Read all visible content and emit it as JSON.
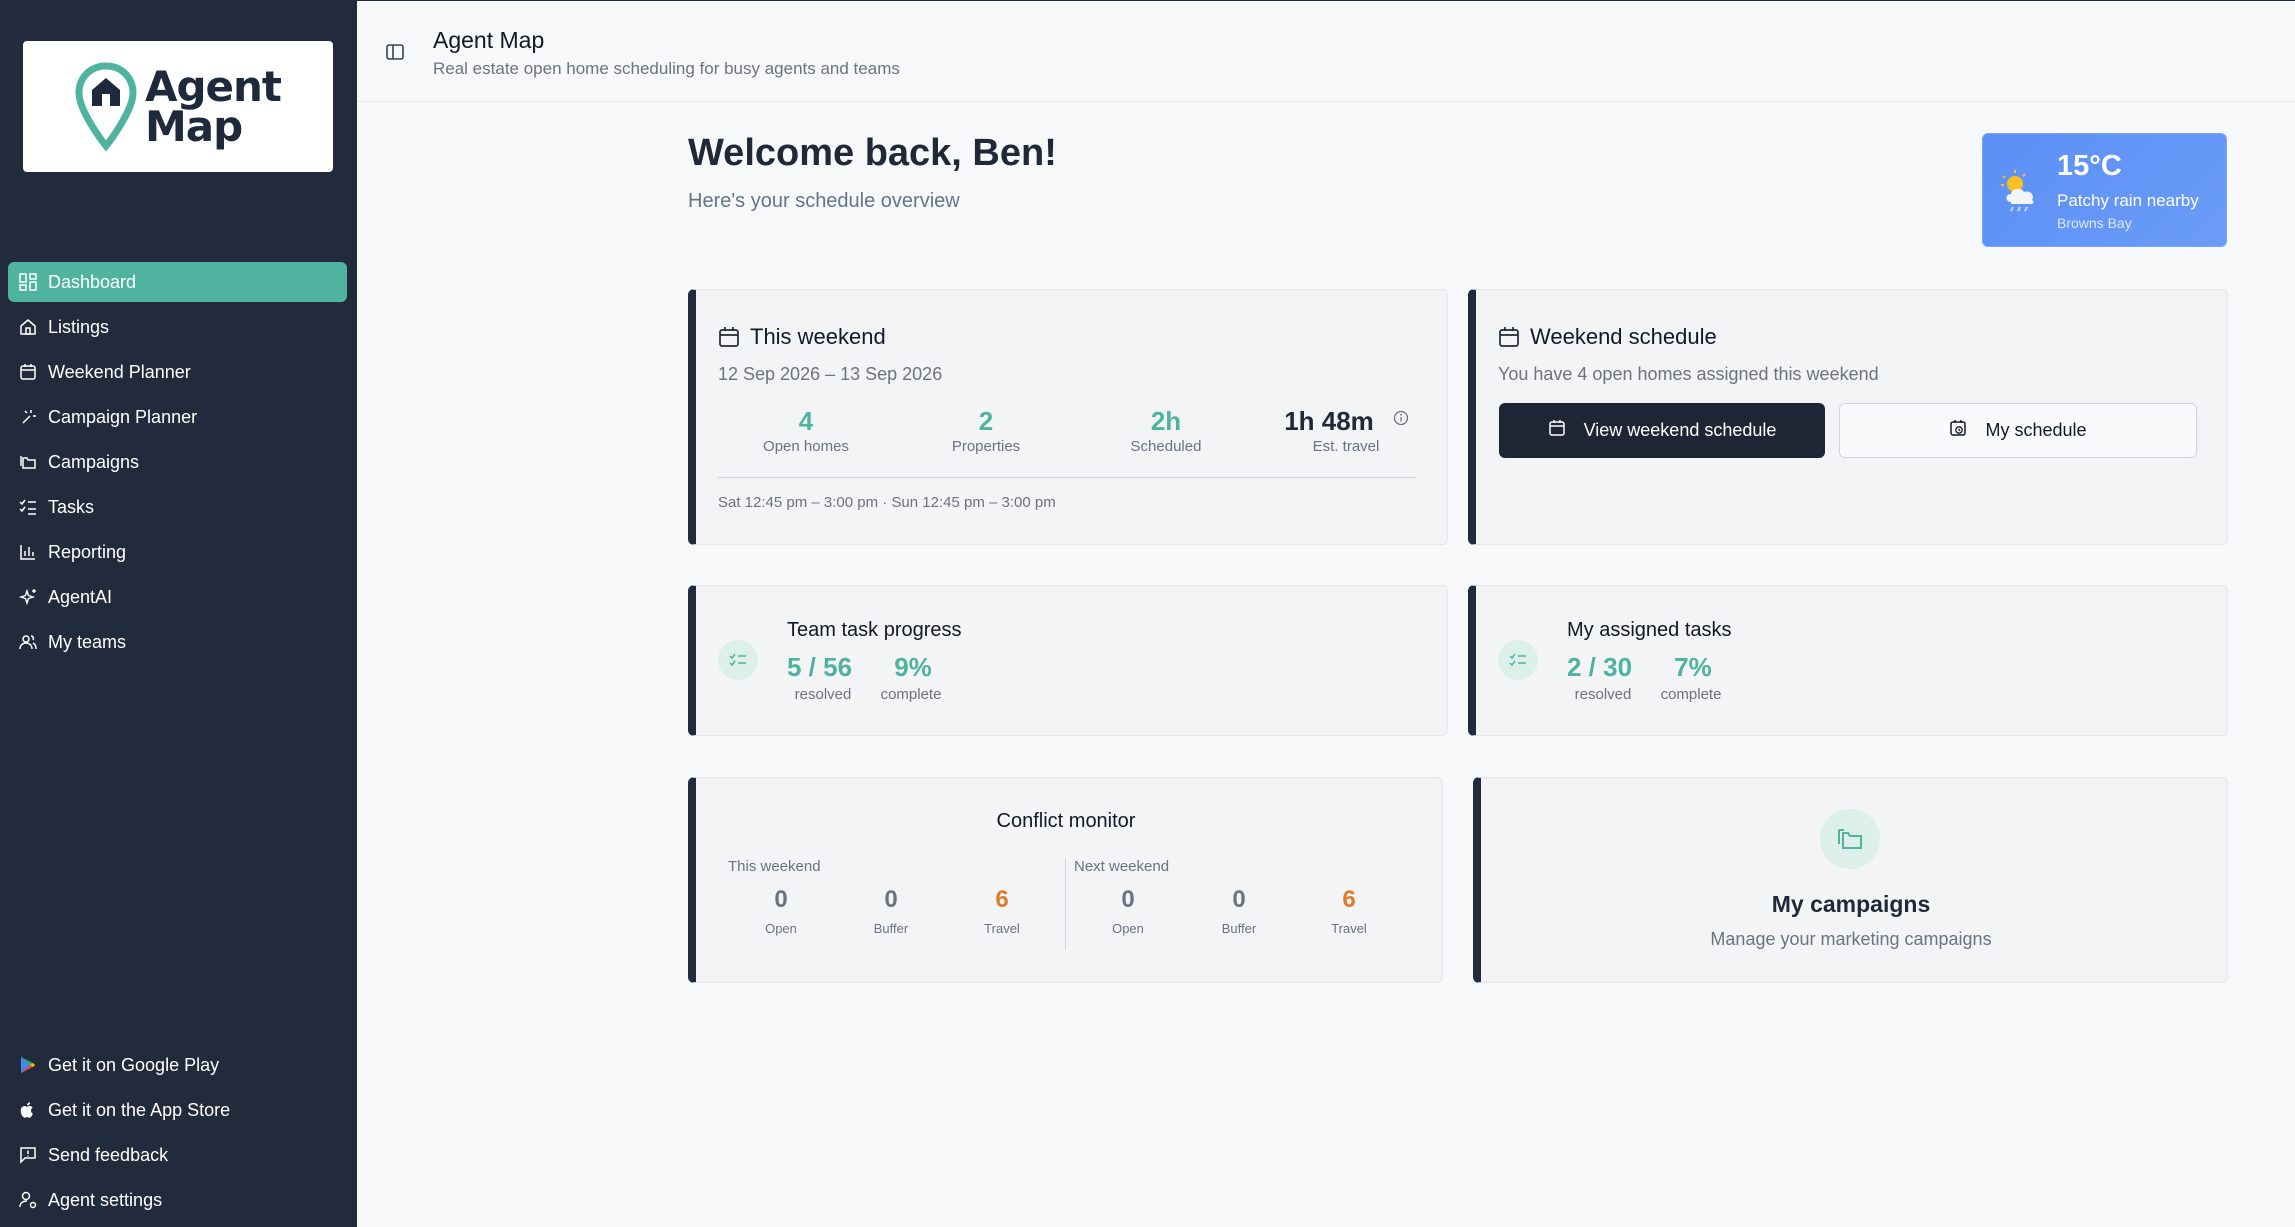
{
  "sidebar": {
    "logo_line1": "Agent",
    "logo_line2": "Map",
    "items": [
      {
        "label": "Dashboard",
        "icon": "dashboard-icon",
        "active": true
      },
      {
        "label": "Listings",
        "icon": "home-icon"
      },
      {
        "label": "Weekend Planner",
        "icon": "calendar-icon"
      },
      {
        "label": "Campaign Planner",
        "icon": "sparkle-wand-icon"
      },
      {
        "label": "Campaigns",
        "icon": "folders-icon"
      },
      {
        "label": "Tasks",
        "icon": "checklist-icon"
      },
      {
        "label": "Reporting",
        "icon": "bar-chart-icon"
      },
      {
        "label": "AgentAI",
        "icon": "sparkles-icon"
      },
      {
        "label": "My teams",
        "icon": "users-icon"
      }
    ],
    "bottom": [
      {
        "label": "Get it on Google Play",
        "icon": "google-play-icon"
      },
      {
        "label": "Get it on the App Store",
        "icon": "apple-icon"
      },
      {
        "label": "Send feedback",
        "icon": "feedback-icon"
      },
      {
        "label": "Agent settings",
        "icon": "user-settings-icon"
      }
    ]
  },
  "header": {
    "title": "Agent Map",
    "subtitle": "Real estate open home scheduling for busy agents and teams"
  },
  "welcome": {
    "title": "Welcome back, Ben!",
    "subtitle": "Here's your schedule overview"
  },
  "weather": {
    "temp": "15°C",
    "condition": "Patchy rain nearby",
    "location": "Browns Bay"
  },
  "this_weekend": {
    "title": "This weekend",
    "dates": "12 Sep 2026 – 13 Sep 2026",
    "stats": [
      {
        "value": "4",
        "label": "Open homes"
      },
      {
        "value": "2",
        "label": "Properties"
      },
      {
        "value": "2h",
        "label": "Scheduled"
      },
      {
        "value": "1h 48m",
        "label": "Est. travel"
      }
    ],
    "times": "Sat 12:45 pm – 3:00 pm · Sun 12:45 pm – 3:00 pm"
  },
  "weekend_schedule": {
    "title": "Weekend schedule",
    "subtitle": "You have 4 open homes assigned this weekend",
    "view_button": "View weekend schedule",
    "my_button": "My schedule"
  },
  "team_tasks": {
    "title": "Team task progress",
    "resolved_value": "5 / 56",
    "resolved_label": "resolved",
    "complete_value": "9%",
    "complete_label": "complete"
  },
  "my_tasks": {
    "title": "My assigned tasks",
    "resolved_value": "2 / 30",
    "resolved_label": "resolved",
    "complete_value": "7%",
    "complete_label": "complete"
  },
  "conflict": {
    "title": "Conflict monitor",
    "this_label": "This weekend",
    "next_label": "Next weekend",
    "this": [
      {
        "value": "0",
        "label": "Open"
      },
      {
        "value": "0",
        "label": "Buffer"
      },
      {
        "value": "6",
        "label": "Travel"
      }
    ],
    "next": [
      {
        "value": "0",
        "label": "Open"
      },
      {
        "value": "0",
        "label": "Buffer"
      },
      {
        "value": "6",
        "label": "Travel"
      }
    ]
  },
  "campaigns": {
    "title": "My campaigns",
    "subtitle": "Manage your marketing campaigns"
  },
  "colors": {
    "sidebar_bg": "#222b3c",
    "accent": "#4fb3a0",
    "warning": "#e07b2a",
    "weather_bg": "#5b8ff5"
  }
}
